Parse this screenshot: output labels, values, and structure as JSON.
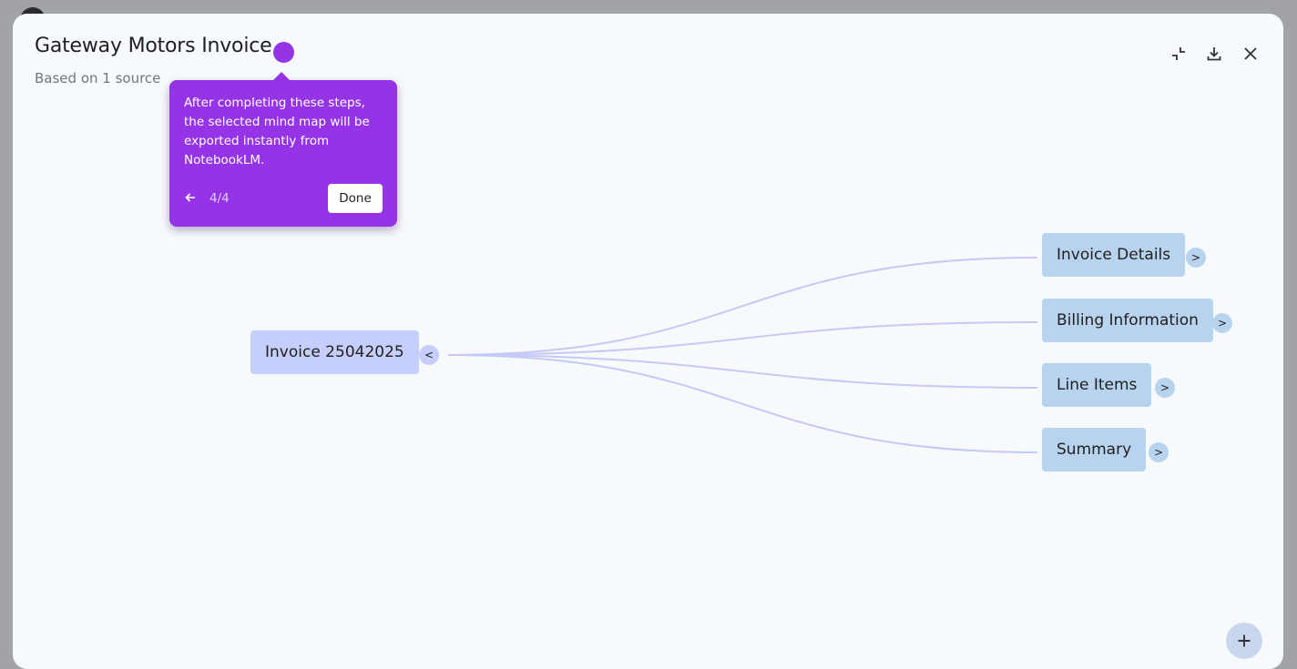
{
  "header": {
    "title": "Gateway Motors Invoice",
    "subtitle": "Based on 1 source"
  },
  "toolbar": {
    "collapse_icon": "collapse-icon",
    "download_icon": "download-icon",
    "close_icon": "close-icon"
  },
  "tour": {
    "text": "After completing these steps, the selected mind map will be exported instantly from NotebookLM.",
    "step": "4/4",
    "done_label": "Done",
    "back_icon": "arrow-left-icon",
    "color": "#9434e6"
  },
  "mindmap": {
    "root": {
      "label": "Invoice 25042025",
      "toggle": "<"
    },
    "children": [
      {
        "label": "Invoice Details",
        "toggle": ">"
      },
      {
        "label": "Billing Information",
        "toggle": ">"
      },
      {
        "label": "Line Items",
        "toggle": ">"
      },
      {
        "label": "Summary",
        "toggle": ">"
      }
    ],
    "connector_color": "#c4c9f5",
    "root_color": "#c6cffb",
    "child_color": "#b8d3ee"
  },
  "zoom": {
    "icon": "plus-icon"
  }
}
